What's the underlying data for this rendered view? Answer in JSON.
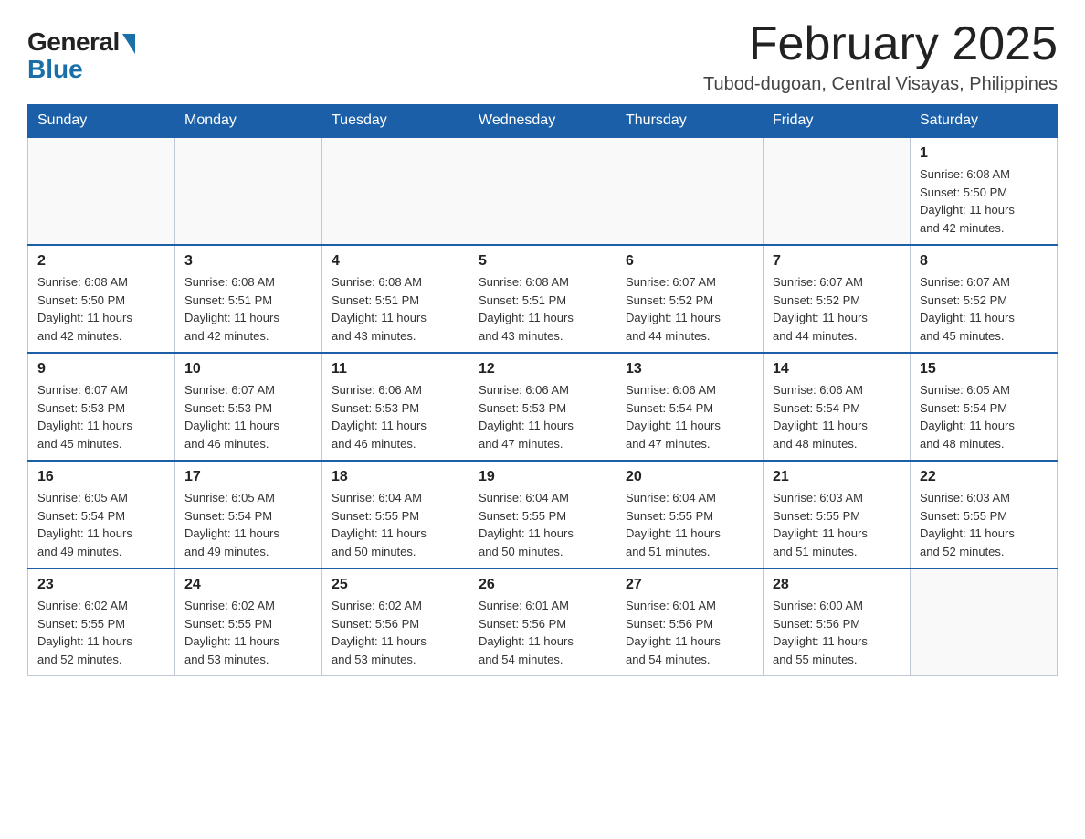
{
  "logo": {
    "general": "General",
    "blue": "Blue"
  },
  "title": "February 2025",
  "subtitle": "Tubod-dugoan, Central Visayas, Philippines",
  "days_of_week": [
    "Sunday",
    "Monday",
    "Tuesday",
    "Wednesday",
    "Thursday",
    "Friday",
    "Saturday"
  ],
  "weeks": [
    [
      {
        "day": "",
        "info": ""
      },
      {
        "day": "",
        "info": ""
      },
      {
        "day": "",
        "info": ""
      },
      {
        "day": "",
        "info": ""
      },
      {
        "day": "",
        "info": ""
      },
      {
        "day": "",
        "info": ""
      },
      {
        "day": "1",
        "info": "Sunrise: 6:08 AM\nSunset: 5:50 PM\nDaylight: 11 hours\nand 42 minutes."
      }
    ],
    [
      {
        "day": "2",
        "info": "Sunrise: 6:08 AM\nSunset: 5:50 PM\nDaylight: 11 hours\nand 42 minutes."
      },
      {
        "day": "3",
        "info": "Sunrise: 6:08 AM\nSunset: 5:51 PM\nDaylight: 11 hours\nand 42 minutes."
      },
      {
        "day": "4",
        "info": "Sunrise: 6:08 AM\nSunset: 5:51 PM\nDaylight: 11 hours\nand 43 minutes."
      },
      {
        "day": "5",
        "info": "Sunrise: 6:08 AM\nSunset: 5:51 PM\nDaylight: 11 hours\nand 43 minutes."
      },
      {
        "day": "6",
        "info": "Sunrise: 6:07 AM\nSunset: 5:52 PM\nDaylight: 11 hours\nand 44 minutes."
      },
      {
        "day": "7",
        "info": "Sunrise: 6:07 AM\nSunset: 5:52 PM\nDaylight: 11 hours\nand 44 minutes."
      },
      {
        "day": "8",
        "info": "Sunrise: 6:07 AM\nSunset: 5:52 PM\nDaylight: 11 hours\nand 45 minutes."
      }
    ],
    [
      {
        "day": "9",
        "info": "Sunrise: 6:07 AM\nSunset: 5:53 PM\nDaylight: 11 hours\nand 45 minutes."
      },
      {
        "day": "10",
        "info": "Sunrise: 6:07 AM\nSunset: 5:53 PM\nDaylight: 11 hours\nand 46 minutes."
      },
      {
        "day": "11",
        "info": "Sunrise: 6:06 AM\nSunset: 5:53 PM\nDaylight: 11 hours\nand 46 minutes."
      },
      {
        "day": "12",
        "info": "Sunrise: 6:06 AM\nSunset: 5:53 PM\nDaylight: 11 hours\nand 47 minutes."
      },
      {
        "day": "13",
        "info": "Sunrise: 6:06 AM\nSunset: 5:54 PM\nDaylight: 11 hours\nand 47 minutes."
      },
      {
        "day": "14",
        "info": "Sunrise: 6:06 AM\nSunset: 5:54 PM\nDaylight: 11 hours\nand 48 minutes."
      },
      {
        "day": "15",
        "info": "Sunrise: 6:05 AM\nSunset: 5:54 PM\nDaylight: 11 hours\nand 48 minutes."
      }
    ],
    [
      {
        "day": "16",
        "info": "Sunrise: 6:05 AM\nSunset: 5:54 PM\nDaylight: 11 hours\nand 49 minutes."
      },
      {
        "day": "17",
        "info": "Sunrise: 6:05 AM\nSunset: 5:54 PM\nDaylight: 11 hours\nand 49 minutes."
      },
      {
        "day": "18",
        "info": "Sunrise: 6:04 AM\nSunset: 5:55 PM\nDaylight: 11 hours\nand 50 minutes."
      },
      {
        "day": "19",
        "info": "Sunrise: 6:04 AM\nSunset: 5:55 PM\nDaylight: 11 hours\nand 50 minutes."
      },
      {
        "day": "20",
        "info": "Sunrise: 6:04 AM\nSunset: 5:55 PM\nDaylight: 11 hours\nand 51 minutes."
      },
      {
        "day": "21",
        "info": "Sunrise: 6:03 AM\nSunset: 5:55 PM\nDaylight: 11 hours\nand 51 minutes."
      },
      {
        "day": "22",
        "info": "Sunrise: 6:03 AM\nSunset: 5:55 PM\nDaylight: 11 hours\nand 52 minutes."
      }
    ],
    [
      {
        "day": "23",
        "info": "Sunrise: 6:02 AM\nSunset: 5:55 PM\nDaylight: 11 hours\nand 52 minutes."
      },
      {
        "day": "24",
        "info": "Sunrise: 6:02 AM\nSunset: 5:55 PM\nDaylight: 11 hours\nand 53 minutes."
      },
      {
        "day": "25",
        "info": "Sunrise: 6:02 AM\nSunset: 5:56 PM\nDaylight: 11 hours\nand 53 minutes."
      },
      {
        "day": "26",
        "info": "Sunrise: 6:01 AM\nSunset: 5:56 PM\nDaylight: 11 hours\nand 54 minutes."
      },
      {
        "day": "27",
        "info": "Sunrise: 6:01 AM\nSunset: 5:56 PM\nDaylight: 11 hours\nand 54 minutes."
      },
      {
        "day": "28",
        "info": "Sunrise: 6:00 AM\nSunset: 5:56 PM\nDaylight: 11 hours\nand 55 minutes."
      },
      {
        "day": "",
        "info": ""
      }
    ]
  ]
}
